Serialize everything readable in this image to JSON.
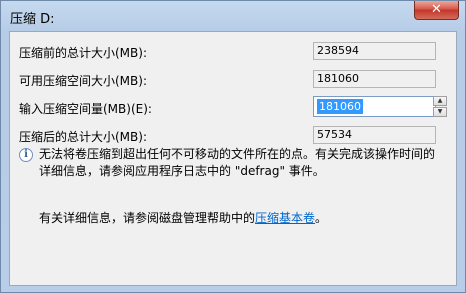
{
  "window": {
    "title": "压缩 D:",
    "close_label": "✕"
  },
  "fields": {
    "total_before_label": "压缩前的总计大小(MB):",
    "total_before_value": "238594",
    "available_label": "可用压缩空间大小(MB):",
    "available_value": "181060",
    "amount_label": "输入压缩空间量(MB)(E):",
    "amount_value": "181060",
    "total_after_label": "压缩后的总计大小(MB):",
    "total_after_value": "57534"
  },
  "info": {
    "line1": "无法将卷压缩到超出任何不可移动的文件所在的点。有关完成该操作时间的",
    "line2": "详细信息，请参阅应用程序日志中的 \"defrag\" 事件。"
  },
  "footer": {
    "prefix": "有关详细信息，请参阅磁盘管理帮助中的",
    "link": "压缩基本卷",
    "suffix": "。"
  },
  "icons": {
    "info": "info-icon",
    "close": "close-icon"
  }
}
